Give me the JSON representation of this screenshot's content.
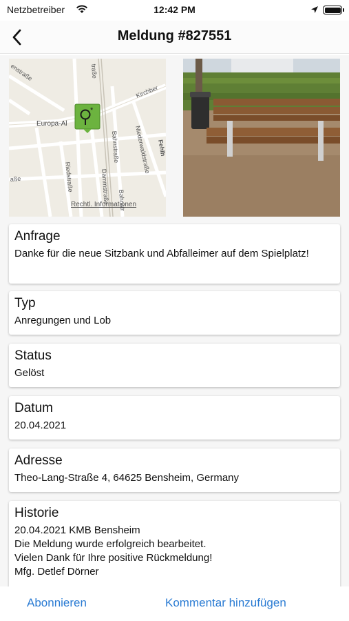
{
  "status_bar": {
    "carrier": "Netzbetreiber",
    "time": "12:42 PM"
  },
  "nav": {
    "title": "Meldung #827551"
  },
  "map": {
    "legal_label": "Rechtl. Informationen",
    "street_labels": {
      "s1": "enstraße",
      "s2": "Kirchber",
      "s3": "Europa-Al",
      "s4": "Bahnstraße",
      "s5": "Niederwaldstraße",
      "s6": "Riedstraße",
      "s7": "Dammstraße",
      "s8": "Bahnstr",
      "s9": "Fehlh",
      "s10": "aße",
      "s11": "traße"
    },
    "pin_color": "#6cb33f"
  },
  "cards": {
    "anfrage": {
      "heading": "Anfrage",
      "value": "Danke für die neue Sitzbank und Abfalleimer auf dem Spielplatz!"
    },
    "typ": {
      "heading": "Typ",
      "value": "Anregungen und Lob"
    },
    "status": {
      "heading": "Status",
      "value": "Gelöst"
    },
    "datum": {
      "heading": "Datum",
      "value": "20.04.2021"
    },
    "adresse": {
      "heading": "Adresse",
      "value": "Theo-Lang-Straße 4, 64625 Bensheim, Germany"
    },
    "historie": {
      "heading": "Historie",
      "lines": [
        "20.04.2021 KMB Bensheim",
        "Die Meldung wurde erfolgreich bearbeitet.",
        "Vielen Dank für Ihre positive Rückmeldung!",
        "Mfg. Detlef Dörner"
      ]
    }
  },
  "actions": {
    "subscribe": "Abonnieren",
    "comment": "Kommentar hinzufügen"
  },
  "colors": {
    "accent": "#2a7bd3",
    "background": "#f6f6f6"
  }
}
